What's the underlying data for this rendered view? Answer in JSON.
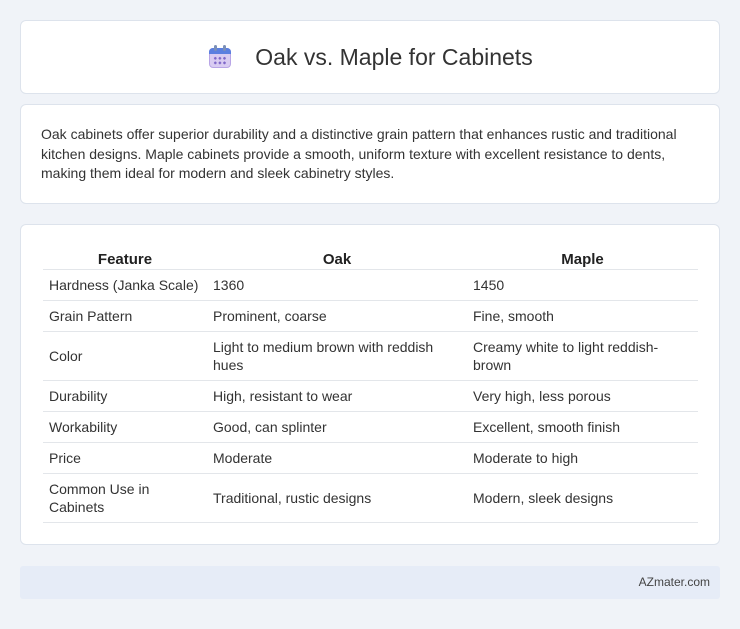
{
  "header": {
    "title": "Oak vs. Maple for Cabinets",
    "icon": "calendar-icon"
  },
  "intro": {
    "text": "Oak cabinets offer superior durability and a distinctive grain pattern that enhances rustic and traditional kitchen designs. Maple cabinets provide a smooth, uniform texture with excellent resistance to dents, making them ideal for modern and sleek cabinetry styles."
  },
  "table": {
    "headers": [
      "Feature",
      "Oak",
      "Maple"
    ],
    "rows": [
      [
        "Hardness (Janka Scale)",
        "1360",
        "1450"
      ],
      [
        "Grain Pattern",
        "Prominent, coarse",
        "Fine, smooth"
      ],
      [
        "Color",
        "Light to medium brown with reddish hues",
        "Creamy white to light reddish-brown"
      ],
      [
        "Durability",
        "High, resistant to wear",
        "Very high, less porous"
      ],
      [
        "Workability",
        "Good, can splinter",
        "Excellent, smooth finish"
      ],
      [
        "Price",
        "Moderate",
        "Moderate to high"
      ],
      [
        "Common Use in Cabinets",
        "Traditional, rustic designs",
        "Modern, sleek designs"
      ]
    ]
  },
  "footer": {
    "credit": "AZmater.com"
  }
}
